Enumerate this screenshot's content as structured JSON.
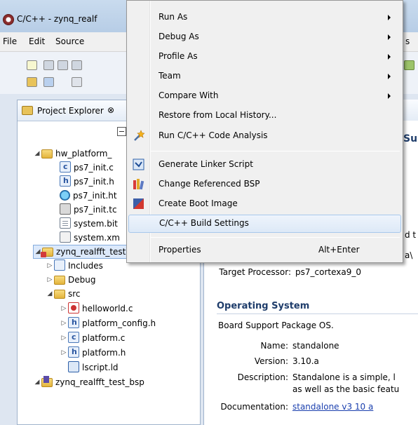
{
  "window": {
    "title": "C/C++ - zynq_realf",
    "menubar": [
      "File",
      "Edit",
      "Source",
      "s"
    ]
  },
  "project_explorer": {
    "tab_label": "Project Explorer",
    "tab_close": "⊗",
    "tree": [
      {
        "label": "hw_platform_",
        "twist": "◢",
        "icon": "folder"
      },
      {
        "label": "ps7_init.c",
        "icon": "c"
      },
      {
        "label": "ps7_init.h",
        "icon": "h"
      },
      {
        "label": "ps7_init.ht",
        "icon": "html"
      },
      {
        "label": "ps7_init.tc",
        "icon": "tcl"
      },
      {
        "label": "system.bit",
        "icon": "doc"
      },
      {
        "label": "system.xm",
        "icon": "xml"
      },
      {
        "label": "zynq_realfft_test",
        "twist": "◢",
        "icon": "project",
        "selected": true
      },
      {
        "label": "Includes",
        "twist": "▷",
        "icon": "lib"
      },
      {
        "label": "Debug",
        "twist": "▷",
        "icon": "folder"
      },
      {
        "label": "src",
        "twist": "◢",
        "icon": "folder"
      },
      {
        "label": "helloworld.c",
        "twist": "▷",
        "icon": "c"
      },
      {
        "label": "platform_config.h",
        "twist": "▷",
        "icon": "h"
      },
      {
        "label": "platform.c",
        "twist": "▷",
        "icon": "c"
      },
      {
        "label": "platform.h",
        "twist": "▷",
        "icon": "h"
      },
      {
        "label": "lscript.ld",
        "icon": "ld"
      },
      {
        "label": "zynq_realfft_test_bsp",
        "twist": "◢",
        "icon": "bsp"
      }
    ]
  },
  "overview": {
    "heading_partial": "Su",
    "cut_line_1": "d t",
    "cut_line_2": "a\\",
    "target_processor_label": "Target Processor:",
    "target_processor_value": "ps7_cortexa9_0",
    "os_heading": "Operating System",
    "bsp_os": "Board Support Package OS.",
    "name_label": "Name:",
    "name_value": "standalone",
    "version_label": "Version:",
    "version_value": "3.10.a",
    "description_label": "Description:",
    "description_line1": "Standalone is a simple, l",
    "description_line2": "as well as the basic featu",
    "documentation_label": "Documentation:",
    "documentation_link": "standalone v3 10 a"
  },
  "context_menu": {
    "items": [
      {
        "label": "Run As",
        "submenu": true
      },
      {
        "label": "Debug As",
        "submenu": true
      },
      {
        "label": "Profile As",
        "submenu": true
      },
      {
        "label": "Team",
        "submenu": true
      },
      {
        "label": "Compare With",
        "submenu": true
      },
      {
        "label": "Restore from Local History..."
      },
      {
        "label": "Run C/C++ Code Analysis",
        "icon": "wand-icon"
      },
      {
        "label": "Generate Linker Script",
        "icon": "linker-script-icon"
      },
      {
        "label": "Change Referenced BSP",
        "icon": "books-icon"
      },
      {
        "label": "Create Boot Image",
        "icon": "boot-image-icon"
      },
      {
        "label": "C/C++ Build Settings",
        "highlighted": true
      },
      {
        "label": "Properties",
        "accelerator": "Alt+Enter"
      }
    ]
  },
  "colors": {
    "menu_bg": "#f0f0f0",
    "highlight_border": "#a8c8ec",
    "link": "#1a3fae",
    "section_heading": "#1f3d6b"
  }
}
